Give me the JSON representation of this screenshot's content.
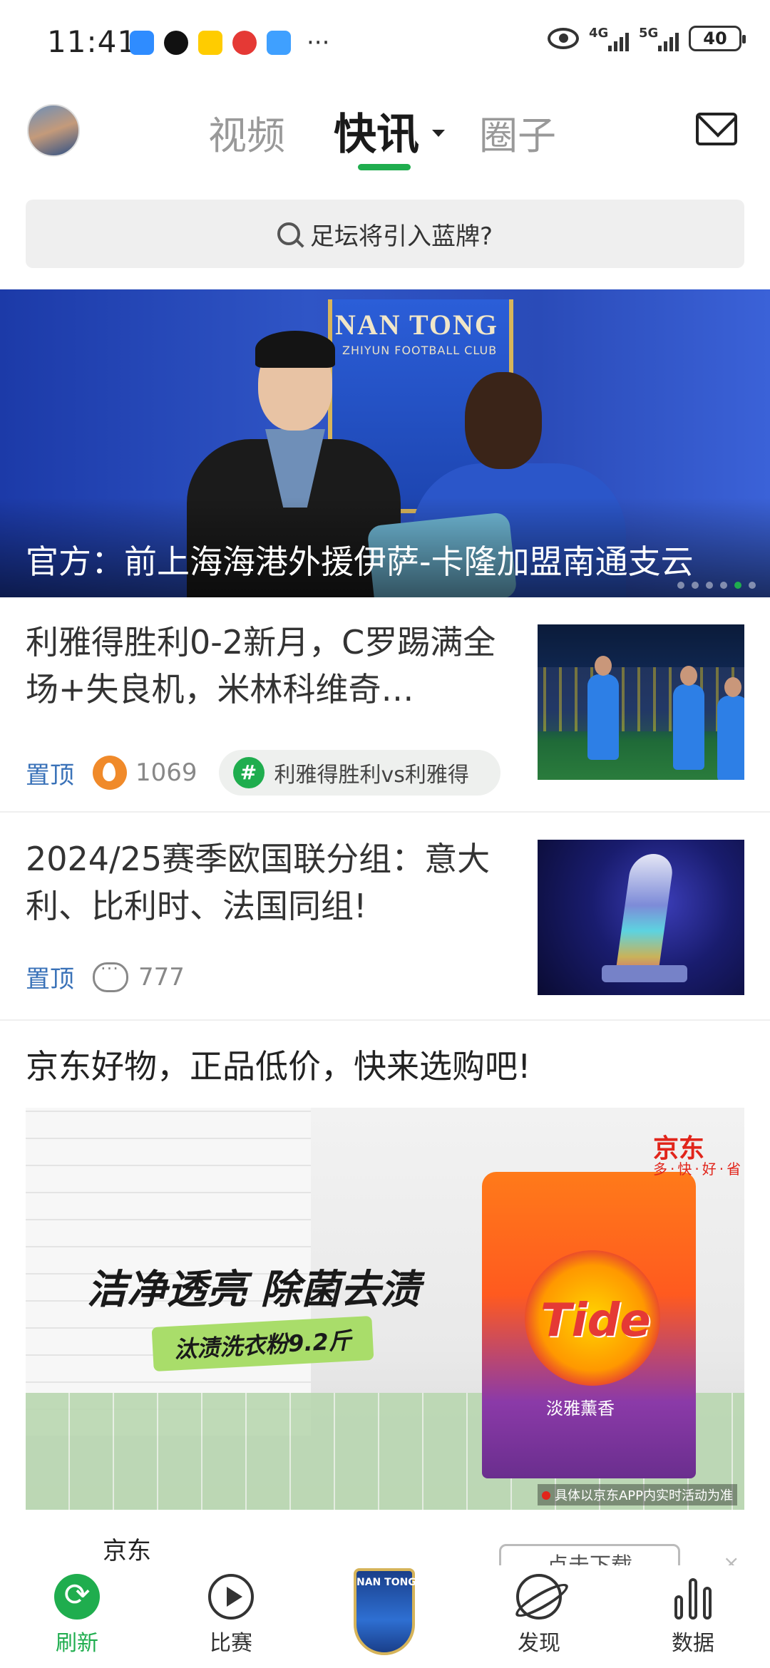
{
  "status_bar": {
    "time": "11:41",
    "notification_icons": [
      "message-icon",
      "qq-icon",
      "meituan-icon",
      "app-icon",
      "weather-icon"
    ],
    "more": "···",
    "network_1": "4G",
    "network_2": "5G",
    "battery": "40"
  },
  "header": {
    "tabs": [
      {
        "label": "视频",
        "active": false
      },
      {
        "label": "快讯",
        "active": true
      },
      {
        "label": "圈子",
        "active": false
      }
    ],
    "accent_color": "#1fad4e"
  },
  "search": {
    "placeholder": "足坛将引入蓝牌?"
  },
  "banner": {
    "title": "官方：前上海海港外援伊萨-卡隆加盟南通支云",
    "board_text": "NAN TONG",
    "board_subtext": "ZHIYUN FOOTBALL CLUB",
    "dot_count": 6,
    "active_dot": 5
  },
  "news": [
    {
      "title": "利雅得胜利0-2新月，C罗踢满全场+失良机，米林科维奇…",
      "pin_label": "置顶",
      "count_icon": "fire-icon",
      "count": "1069",
      "topic": "利雅得胜利vs利雅得",
      "topic_icon": "hash-icon"
    },
    {
      "title": "2024/25赛季欧国联分组：意大利、比利时、法国同组!",
      "pin_label": "置顶",
      "count_icon": "comment-icon",
      "count": "777"
    }
  ],
  "ad": {
    "title": "京东好物，正品低价，快来选购吧!",
    "headline": "洁净透亮 除菌去渍",
    "product_pill": "汰渍洗衣粉9.2斤",
    "jd_brand": "京东",
    "jd_slogan": "多·快·好·省",
    "product_brand": "Tide",
    "product_sub": "淡雅薰香",
    "disclaimer": "具体以京东APP内实时活动为准",
    "source": "京东",
    "download_label": "点击下载",
    "close": "×"
  },
  "bottom_nav": {
    "items": [
      {
        "label": "刷新",
        "icon": "refresh-icon",
        "active": true
      },
      {
        "label": "比赛",
        "icon": "play-icon",
        "active": false
      },
      {
        "label": "发现",
        "icon": "planet-icon",
        "active": false
      },
      {
        "label": "数据",
        "icon": "bars-icon",
        "active": false
      }
    ],
    "center_logo_text": "NAN TONG"
  }
}
